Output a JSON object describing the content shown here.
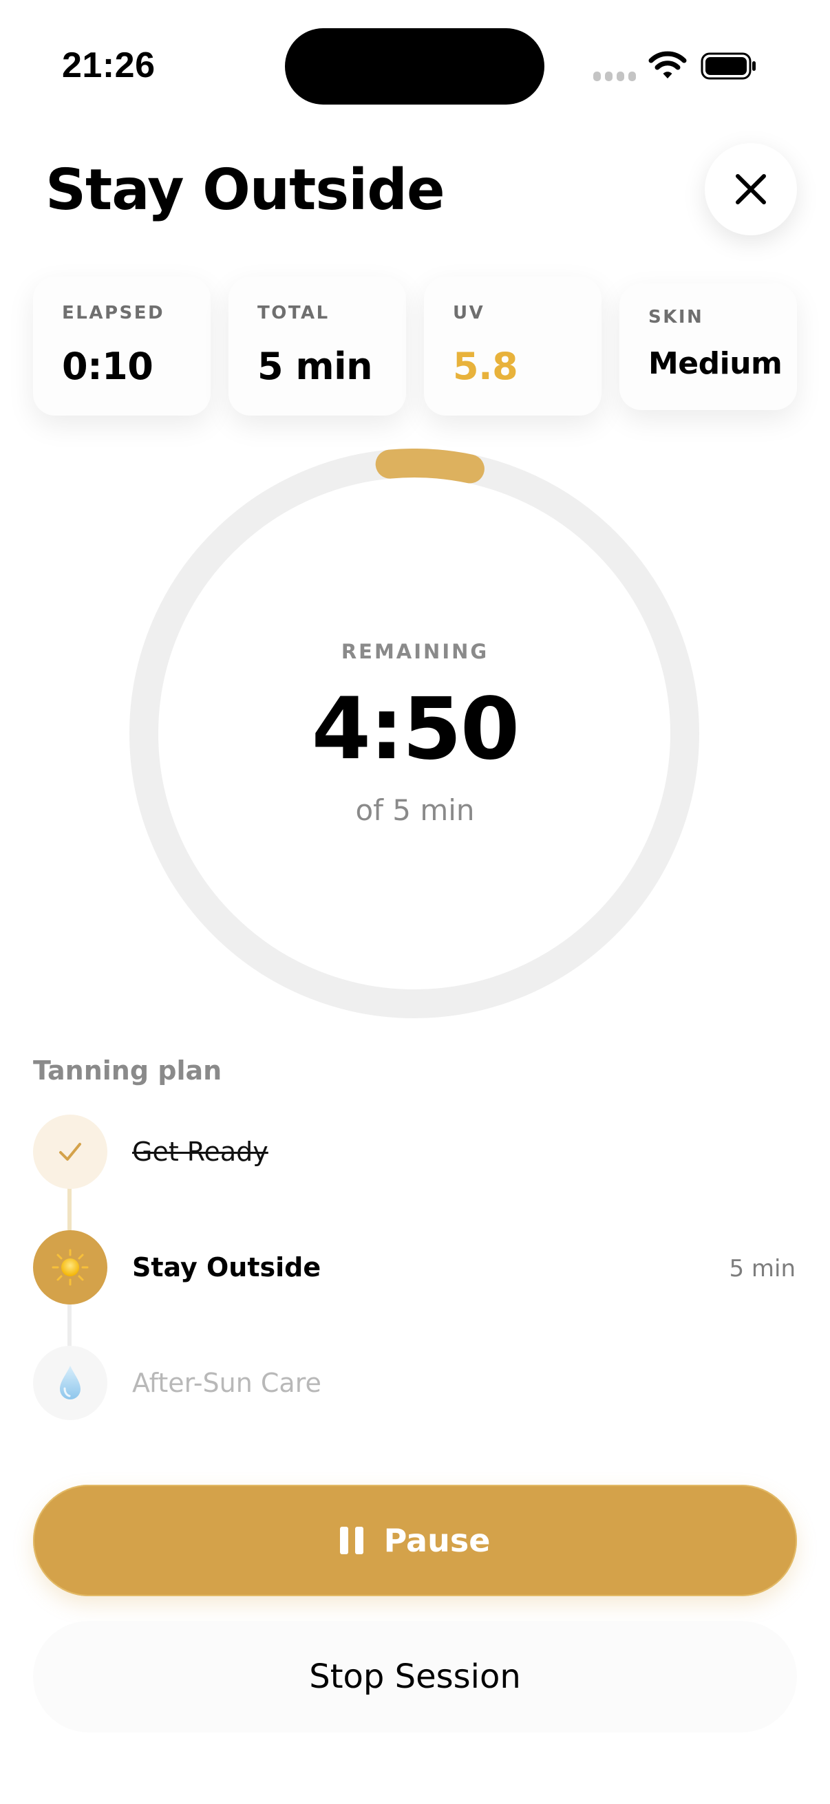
{
  "status_bar": {
    "time": "21:26"
  },
  "header": {
    "title": "Stay Outside",
    "close_icon": "close-icon"
  },
  "stats": [
    {
      "label": "ELAPSED",
      "value": "0:10",
      "value_color": "#000000"
    },
    {
      "label": "TOTAL",
      "value": "5 min",
      "value_color": "#000000"
    },
    {
      "label": "UV",
      "value": "5.8",
      "value_color": "#E8B23B"
    },
    {
      "label": "SKIN",
      "value": "Medium",
      "value_color": "#000000"
    }
  ],
  "timer": {
    "label": "REMAINING",
    "remaining": "4:50",
    "subtitle": "of 5 min",
    "progress_fraction": 0.033,
    "ring_track_color": "#EFEFEF",
    "ring_progress_color": "#DDB15E"
  },
  "plan": {
    "heading": "Tanning plan",
    "steps": [
      {
        "label": "Get Ready",
        "state": "done",
        "icon": "checkmark-icon"
      },
      {
        "label": "Stay Outside",
        "state": "active",
        "icon": "sun-icon",
        "duration": "5 min"
      },
      {
        "label": "After-Sun Care",
        "state": "upcoming",
        "icon": "water-drop-icon"
      }
    ]
  },
  "actions": {
    "pause_label": "Pause",
    "stop_label": "Stop Session"
  },
  "colors": {
    "accent": "#D4A24A",
    "done_step_bg": "#FAF1E3",
    "future_step_bg": "#F6F6F6"
  }
}
